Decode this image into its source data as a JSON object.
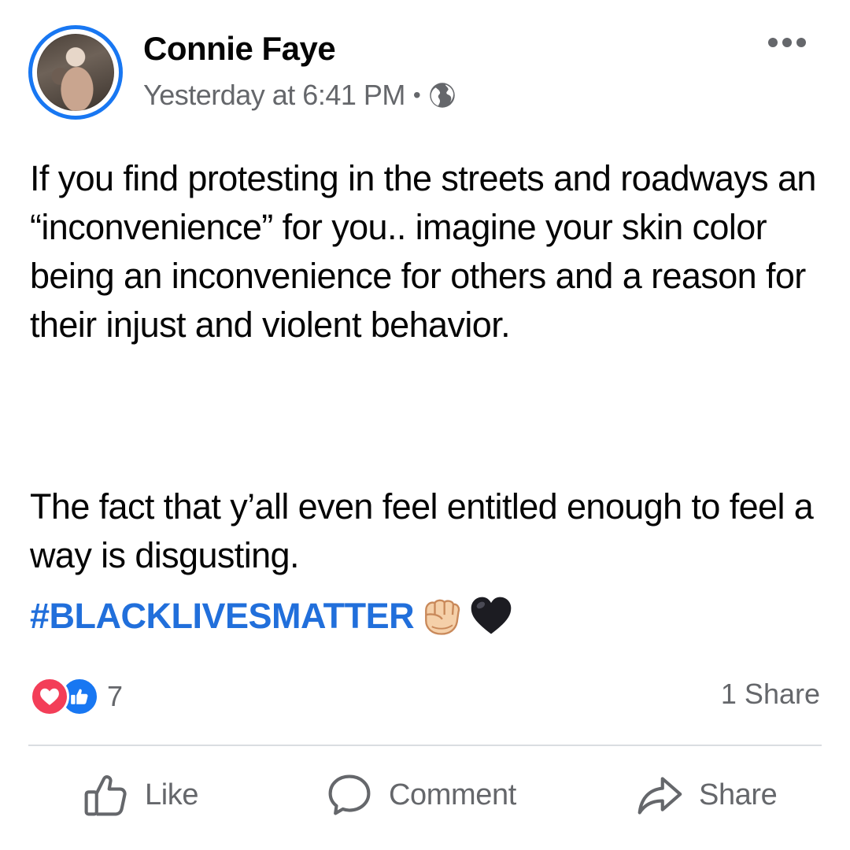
{
  "post": {
    "author": "Connie Faye",
    "timestamp": "Yesterday at 6:41 PM",
    "separator": "•",
    "privacy_icon": "globe-icon",
    "more_icon": "more-options-icon",
    "paragraphs": [
      "If you find protesting in the streets and roadways an “inconvenience” for you.. imagine your skin color being an inconvenience for others and a reason for their injust and violent behavior.",
      "The fact that y’all even feel entitled enough to feel a way is disgusting."
    ],
    "hashtag": "#BLACKLIVESMATTER",
    "emojis": [
      "raised-fist-icon",
      "black-heart-icon"
    ]
  },
  "engagement": {
    "reaction_icons": [
      "love-icon",
      "like-icon"
    ],
    "reaction_count": "7",
    "share_count": "1 Share"
  },
  "actions": {
    "like_label": "Like",
    "comment_label": "Comment",
    "share_label": "Share"
  },
  "colors": {
    "accent": "#1877f2",
    "hashtag": "#216fdb",
    "secondary_text": "#65676b",
    "love": "#f33e58"
  }
}
